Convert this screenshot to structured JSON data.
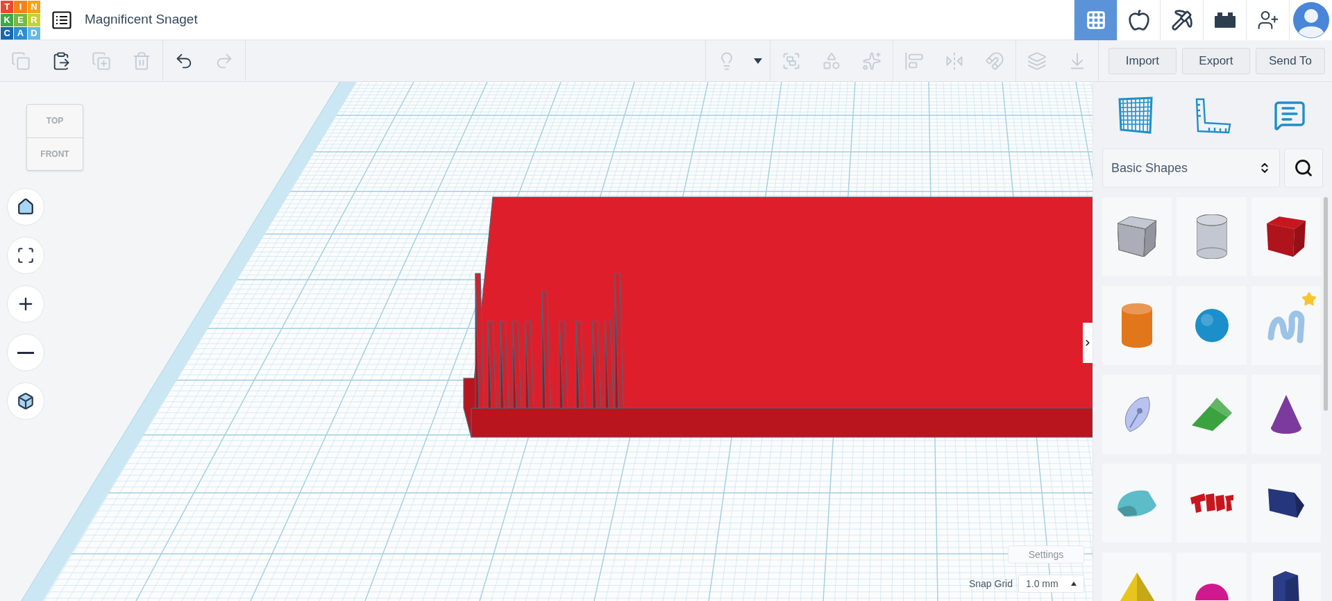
{
  "header": {
    "logo": [
      {
        "letter": "T",
        "color": "#e84a2f"
      },
      {
        "letter": "I",
        "color": "#f3821e"
      },
      {
        "letter": "N",
        "color": "#f6a21d"
      },
      {
        "letter": "K",
        "color": "#3fa845"
      },
      {
        "letter": "E",
        "color": "#76b843"
      },
      {
        "letter": "R",
        "color": "#c6d132"
      },
      {
        "letter": "C",
        "color": "#1768b3"
      },
      {
        "letter": "A",
        "color": "#2c8dd4"
      },
      {
        "letter": "D",
        "color": "#6ab7e3"
      }
    ],
    "title": "Magnificent Snaget"
  },
  "nav": [
    {
      "kind": "grid",
      "selected": true
    },
    {
      "kind": "apple",
      "selected": false
    },
    {
      "kind": "pickaxe",
      "selected": false
    },
    {
      "kind": "brick",
      "selected": false
    },
    {
      "kind": "add-user",
      "selected": false
    },
    {
      "kind": "avatar",
      "selected": false
    }
  ],
  "toolbar": {
    "tool_groups": [
      [
        {
          "kind": "copy",
          "disabled": true
        },
        {
          "kind": "paste",
          "disabled": false
        },
        {
          "kind": "duplicate",
          "disabled": true
        },
        {
          "kind": "delete",
          "disabled": true
        }
      ],
      [
        {
          "kind": "undo",
          "disabled": false
        },
        {
          "kind": "redo",
          "disabled": true
        }
      ]
    ],
    "shape_tool_groups": [
      [
        {
          "kind": "light",
          "disabled": true
        },
        {
          "kind": "menu",
          "disabled": false
        }
      ],
      [
        {
          "kind": "group",
          "disabled": true
        },
        {
          "kind": "solid",
          "disabled": true
        },
        {
          "kind": "scatter",
          "disabled": true
        }
      ],
      [
        {
          "kind": "align",
          "disabled": true
        },
        {
          "kind": "mirror",
          "disabled": true
        },
        {
          "kind": "magnet",
          "disabled": true
        }
      ],
      [
        {
          "kind": "cruise",
          "disabled": true
        },
        {
          "kind": "drop",
          "disabled": true
        }
      ]
    ],
    "buttons": [
      "Import",
      "Export",
      "Send To"
    ]
  },
  "view_cube": {
    "top": "TOP",
    "front": "FRONT"
  },
  "view_controls": [
    {
      "kind": "home"
    },
    {
      "kind": "fit"
    },
    {
      "kind": "zoom-in"
    },
    {
      "kind": "zoom-out"
    },
    {
      "kind": "ortho"
    }
  ],
  "settings": "Settings",
  "snap_grid": {
    "label": "Snap Grid",
    "value": "1.0 mm"
  },
  "panel": {
    "tabs": [
      {
        "kind": "workplane"
      },
      {
        "kind": "ruler"
      },
      {
        "kind": "notes"
      }
    ],
    "category": "Basic Shapes",
    "shapes": [
      {
        "kind": "box-hole",
        "color": "#c3c7d2",
        "starred": false
      },
      {
        "kind": "cylinder-hole",
        "color": "#c3c7d2",
        "starred": false
      },
      {
        "kind": "box",
        "color": "#c8161f",
        "starred": false
      },
      {
        "kind": "cylinder",
        "color": "#e2761a",
        "starred": false
      },
      {
        "kind": "sphere",
        "color": "#1b8fc9",
        "starred": false
      },
      {
        "kind": "scribble",
        "color": "#9cc3e6",
        "starred": true
      },
      {
        "kind": "pin",
        "color": "#b9c3ef",
        "starred": false
      },
      {
        "kind": "roof",
        "color": "#3aa33f",
        "starred": false
      },
      {
        "kind": "cone",
        "color": "#7c3a9e",
        "starred": false
      },
      {
        "kind": "half-cylinder",
        "color": "#5cbcc8",
        "starred": false
      },
      {
        "kind": "text",
        "color": "#c8161f",
        "starred": false
      },
      {
        "kind": "wedge",
        "color": "#25367a",
        "starred": false
      },
      {
        "kind": "pyramid",
        "color": "#e8c51c",
        "starred": false
      },
      {
        "kind": "half-sphere",
        "color": "#d1198f",
        "starred": false
      },
      {
        "kind": "prism",
        "color": "#2a3d86",
        "starred": false
      }
    ]
  }
}
